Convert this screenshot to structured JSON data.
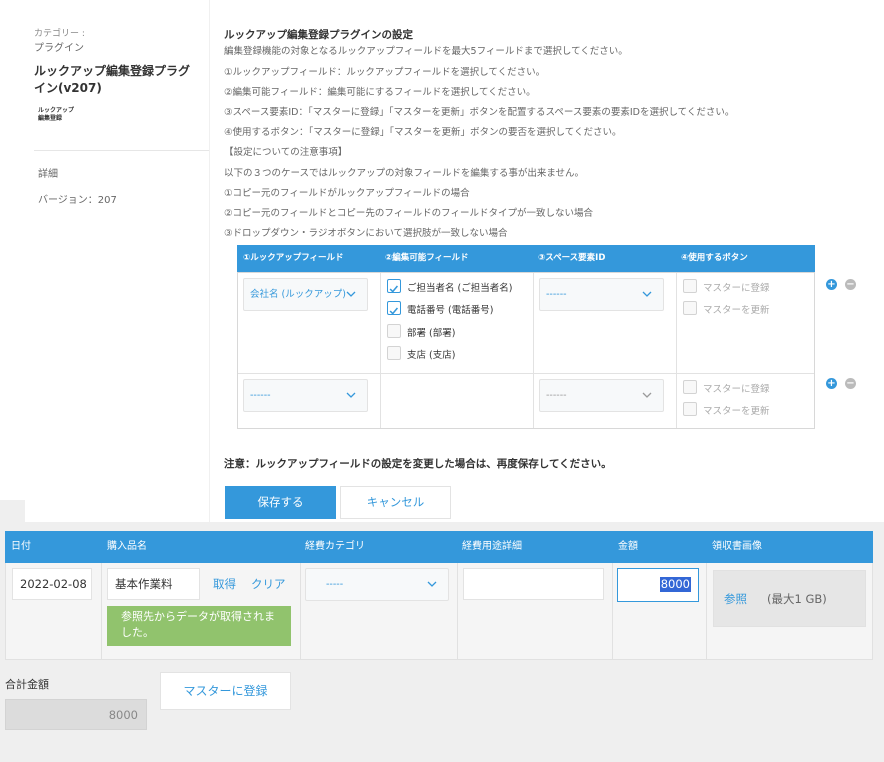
{
  "sidebar": {
    "category_label": "カテゴリー :",
    "category_value": "プラグイン",
    "plugin_title": "ルックアップ編集登録プラグイン(v207)",
    "logo_line1": "ルックアップ",
    "logo_line2": "編集登録",
    "details_label": "詳細",
    "version_text": "バージョン：207"
  },
  "settings": {
    "title": "ルックアップ編集登録プラグインの設定",
    "description_lines": [
      "編集登録機能の対象となるルックアップフィールドを最大5フィールドまで選択してください。",
      "①ルックアップフィールド：ルックアップフィールドを選択してください。",
      "②編集可能フィールド：編集可能にするフィールドを選択してください。",
      "③スペース要素ID：「マスターに登録」「マスターを更新」ボタンを配置するスペース要素の要素IDを選択してください。",
      "④使用するボタン：「マスターに登録」「マスターを更新」ボタンの要否を選択してください。",
      "【設定についての注意事項】",
      "以下の３つのケースではルックアップの対象フィールドを編集する事が出来ません。",
      "①コピー元のフィールドがルックアップフィールドの場合",
      "②コピー元のフィールドとコピー先のフィールドのフィールドタイプが一致しない場合",
      "③ドロップダウン・ラジオボタンにおいて選択肢が一致しない場合"
    ],
    "table_headers": [
      "①ルックアップフィールド",
      "②編集可能フィールド",
      "③スペース要素ID",
      "④使用するボタン"
    ],
    "rows": [
      {
        "lookup_value": "会社名 (ルックアップ)",
        "editable_fields": [
          {
            "label": "ご担当者名 (ご担当者名)",
            "checked": true
          },
          {
            "label": "電話番号 (電話番号)",
            "checked": true
          },
          {
            "label": "部署 (部署)",
            "checked": false
          },
          {
            "label": "支店 (支店)",
            "checked": false
          }
        ],
        "space_value": "------",
        "buttons": [
          {
            "label": "マスターに登録",
            "checked": false
          },
          {
            "label": "マスターを更新",
            "checked": false
          }
        ]
      },
      {
        "lookup_value": "------",
        "editable_fields": [],
        "space_value": "------",
        "buttons": [
          {
            "label": "マスターに登録",
            "checked": false
          },
          {
            "label": "マスターを更新",
            "checked": false
          }
        ]
      }
    ],
    "add_symbol": "+",
    "remove_symbol": "−",
    "note": "注意：ルックアップフィールドの設定を変更した場合は、再度保存してください。",
    "save_label": "保存する",
    "cancel_label": "キャンセル"
  },
  "record": {
    "headers": [
      "日付",
      "購入品名",
      "経費カテゴリ",
      "経費用途詳細",
      "金額",
      "領収書画像"
    ],
    "date_value": "2022-02-08",
    "item_value": "基本作業料",
    "fetch_link": "取得",
    "clear_link": "クリア",
    "success_message": "参照先からデータが取得されました。",
    "category_value": "-----",
    "detail_value": "",
    "amount_value": "8000",
    "browse_label": "参照",
    "max_size_label": "(最大1 GB)",
    "total_label": "合計金額",
    "total_value": "8000",
    "register_button": "マスターに登録"
  },
  "colors": {
    "accent": "#3498db",
    "success": "#91c36d"
  }
}
